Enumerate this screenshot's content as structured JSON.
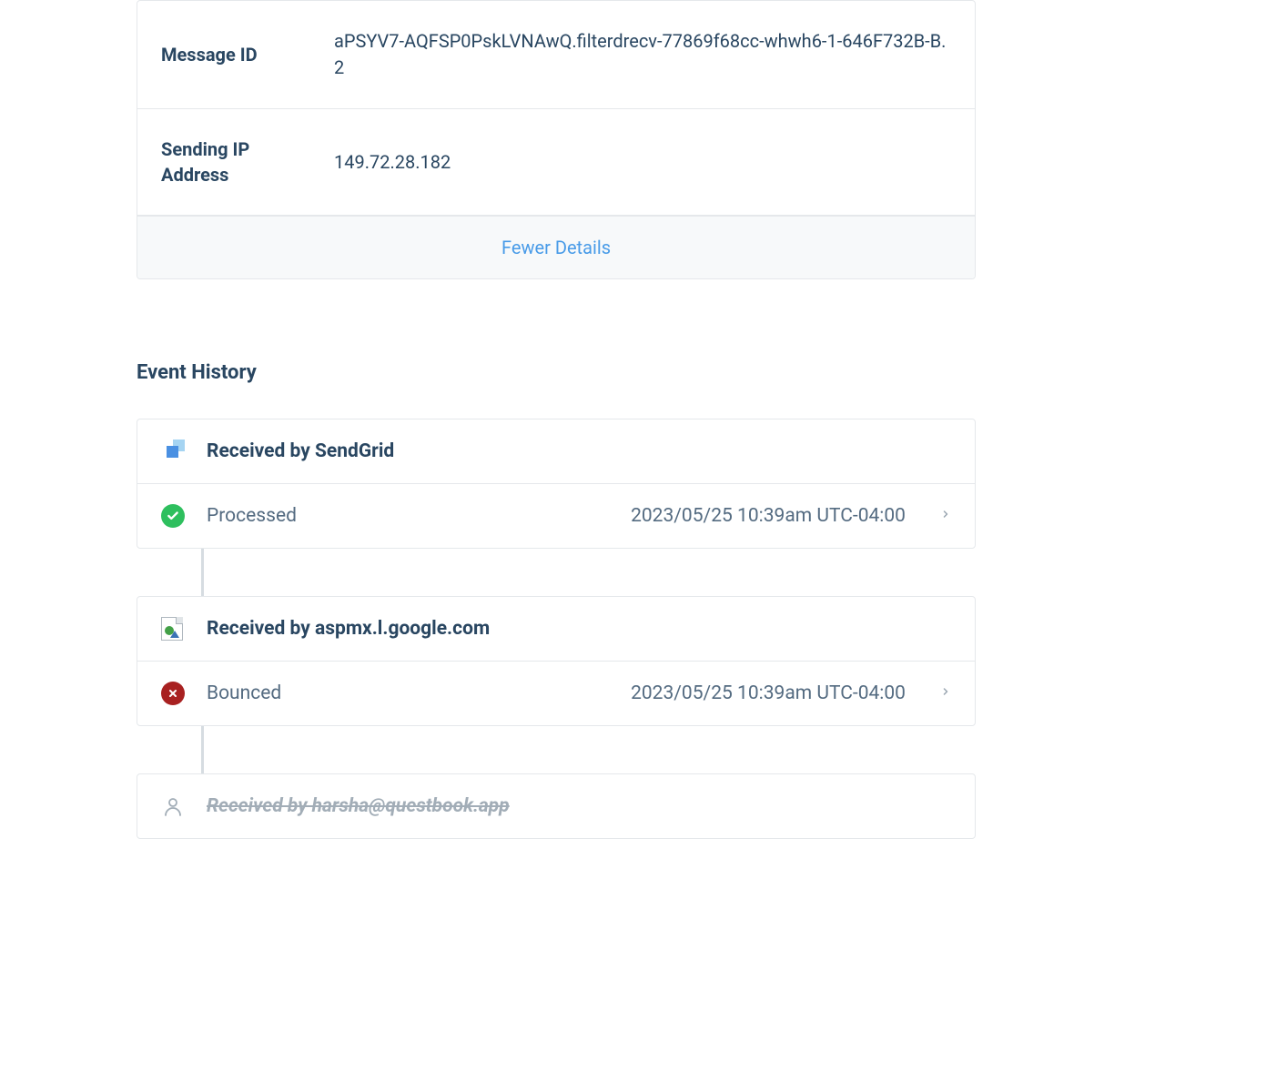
{
  "details": {
    "message_id_label": "Message ID",
    "message_id_value": "aPSYV7-AQFSP0PskLVNAwQ.filterdrecv-77869f68cc-whwh6-1-646F732B-B.2",
    "sending_ip_label": "Sending IP Address",
    "sending_ip_value": "149.72.28.182",
    "toggle_label": "Fewer Details"
  },
  "event_history": {
    "title": "Event History",
    "groups": [
      {
        "icon": "sendgrid",
        "header": "Received by SendGrid",
        "events": [
          {
            "icon": "check",
            "name": "Processed",
            "time": "2023/05/25 10:39am UTC-04:00"
          }
        ]
      },
      {
        "icon": "server",
        "header": "Received by aspmx.l.google.com",
        "events": [
          {
            "icon": "x",
            "name": "Bounced",
            "time": "2023/05/25 10:39am UTC-04:00"
          }
        ]
      },
      {
        "icon": "person",
        "header": "Received by harsha@questbook.app",
        "strike": true,
        "events": []
      }
    ]
  }
}
